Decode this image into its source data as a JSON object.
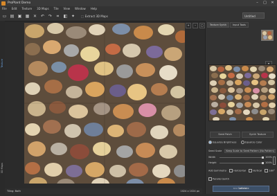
{
  "window": {
    "title": "ProPlant Demo",
    "minimize": "–",
    "maximize": "□",
    "close": "✕"
  },
  "menu": [
    "File",
    "Edit",
    "Texture",
    "3D Maps",
    "Tile",
    "View",
    "Window",
    "Help"
  ],
  "toolbar": {
    "extract_label": "Extract 3D Maps",
    "right_dropdown": "Untitled"
  },
  "left_tabs": {
    "top": "Texture",
    "bottom": "3D Maps"
  },
  "canvas_controls": [
    "+",
    "–",
    "□"
  ],
  "status": {
    "tiling_label": "Tiling: Both",
    "size": "1024 x 1024 px"
  },
  "panel": {
    "tabs": [
      "Texture Synth",
      "Input Tools"
    ],
    "source_button": "Seed Patch",
    "synth_button": "Synth Texture",
    "equalize": {
      "brightness": "Equalize Brightness",
      "color": "Equalize Color"
    },
    "seed_scale": {
      "label": "Seed Scale",
      "mode": "Keep Scale to Seed Pattern (No Pattern)"
    },
    "width": {
      "label": "Width",
      "value": "100%"
    },
    "height": {
      "label": "Height",
      "value": "100%"
    },
    "add_symmetry": {
      "label": "Add Symmetry",
      "horizontal": "Horizontal",
      "vertical": "Vertical",
      "angle": "180°"
    },
    "parallel_synth": "Parallel Synth",
    "generate": "<< Generate",
    "hide": "Hide"
  }
}
